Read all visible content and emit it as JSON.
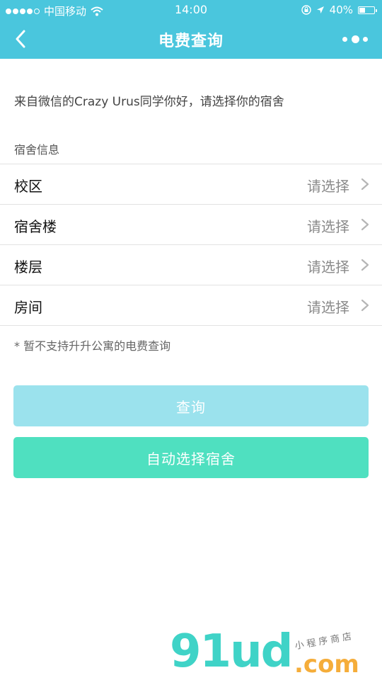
{
  "status_bar": {
    "carrier": "中国移动",
    "time": "14:00",
    "battery_percent_text": "40%",
    "battery_level": 0.4,
    "icons": [
      "signal-dots-icon",
      "wifi-icon",
      "orientation-lock-icon",
      "location-arrow-icon",
      "battery-icon"
    ]
  },
  "nav": {
    "title": "电费查询",
    "back_icon": "chevron-left-icon",
    "more_icon": "more-dots-icon"
  },
  "colors": {
    "header": "#4ac6dd",
    "query_button": "#9be2ed",
    "auto_button": "#4fe0c0"
  },
  "greeting": "来自微信的Crazy Urus同学你好，请选择你的宿舍",
  "section_title": "宿舍信息",
  "rows": [
    {
      "label": "校区",
      "value": "请选择"
    },
    {
      "label": "宿舍楼",
      "value": "请选择"
    },
    {
      "label": "楼层",
      "value": "请选择"
    },
    {
      "label": "房间",
      "value": "请选择"
    }
  ],
  "note": "* 暂不支持升升公寓的电费查询",
  "buttons": {
    "query": "查询",
    "auto_select": "自动选择宿舍"
  },
  "watermark": {
    "logo": "91ud",
    "subtitle": "小程序商店",
    "domain": ".com"
  }
}
